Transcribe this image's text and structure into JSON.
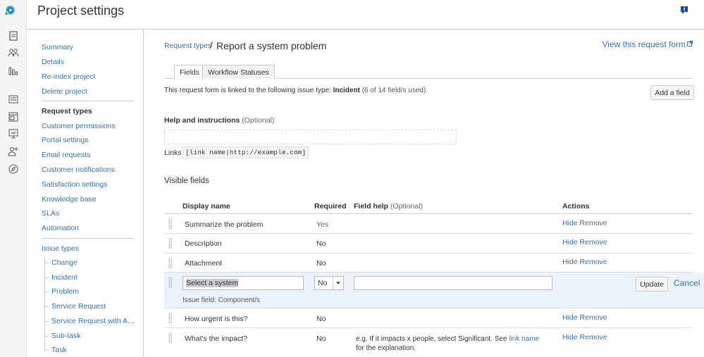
{
  "app": {
    "title": "Project settings"
  },
  "rail": {
    "icons": [
      "app-logo-icon",
      "page-icon",
      "people-icon",
      "reports-icon",
      "queue-icon",
      "portal-icon",
      "monitor-icon",
      "add-user-icon",
      "compass-icon"
    ]
  },
  "sidebar": {
    "group1": [
      "Summary",
      "Details",
      "Re-index project",
      "Delete project"
    ],
    "group2": [
      "Request types",
      "Customer permissions",
      "Portal settings",
      "Email requests",
      "Customer notifications",
      "Satisfaction settings",
      "Knowledge base",
      "SLAs",
      "Automation"
    ],
    "issue_types_label": "Issue types",
    "issue_types": [
      "Change",
      "Incident",
      "Problem",
      "Service Request",
      "Service Request with A…",
      "Sub-task",
      "Task"
    ]
  },
  "main": {
    "breadcrumb": "Request types",
    "crumb_sep": "/",
    "title": "Report a system problem",
    "view_form": "View this request form",
    "tabs": [
      "Fields",
      "Workflow Statuses"
    ],
    "linked_text_prefix": "This request form is linked to the following issue type: ",
    "linked_issue_type": "Incident",
    "linked_usage": "(6 of 14 field/s used)",
    "add_field_label": "Add a field",
    "help_label": "Help and instructions",
    "optional": "(Optional)",
    "links_label": "Links",
    "links_code": "[link name|http://example.com]",
    "visible_fields_title": "Visible fields"
  },
  "table": {
    "headers": {
      "display_name": "Display name",
      "required": "Required",
      "field_help": "Field help",
      "field_help_optional": "(Optional)",
      "actions": "Actions"
    },
    "hide_label": "Hide",
    "remove_label": "Remove",
    "rows": [
      {
        "name": "Summarize the problem",
        "required": "Yes"
      },
      {
        "name": "Description",
        "required": "No"
      },
      {
        "name": "Attachment",
        "required": "No"
      }
    ],
    "editing": {
      "name_value": "Select a system",
      "required_value": "No",
      "help_value": "",
      "update_label": "Update",
      "cancel_label": "Cancel",
      "issue_field": "Issue field: Component/s"
    },
    "rows_after": [
      {
        "name": "How urgent is this?",
        "required": "No"
      },
      {
        "name": "What's the impact?",
        "required": "No",
        "help_line1_prefix": "e.g. If it impacts x people, select Significant. See ",
        "help_link": "link name",
        "help_line2": "for the explanation."
      }
    ]
  },
  "colors": {
    "link": "#3572b0",
    "editing_row": "#ebf2f9"
  }
}
